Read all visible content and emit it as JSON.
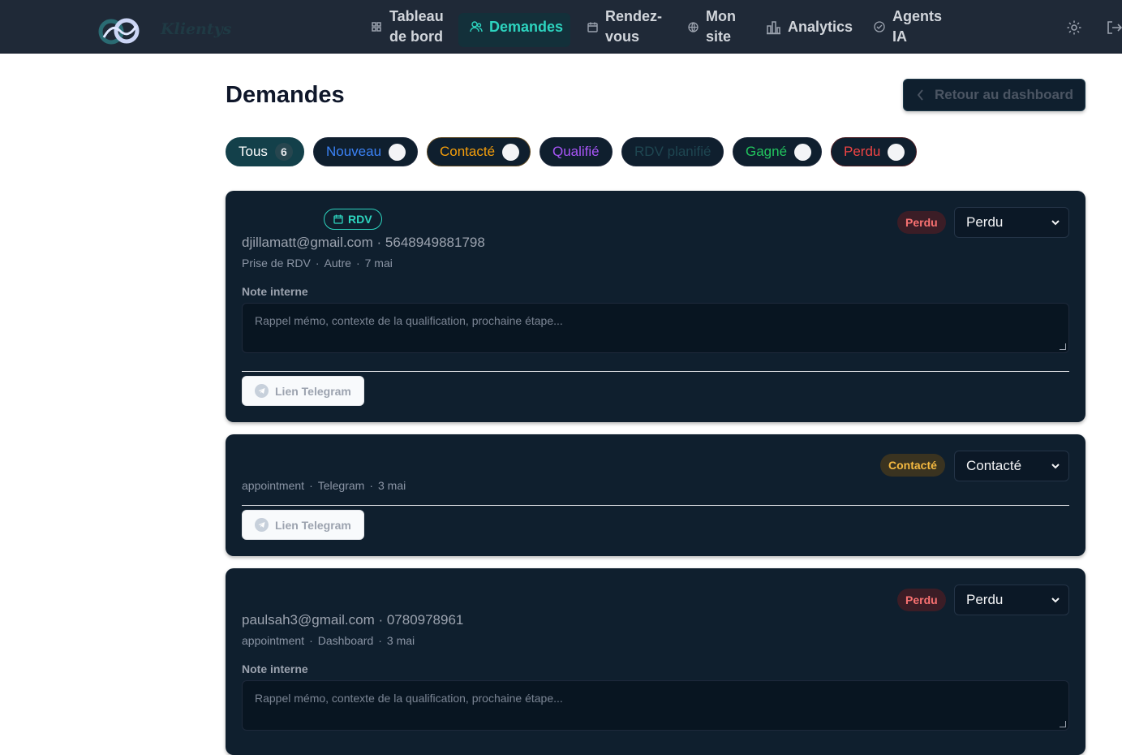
{
  "app": {
    "brand": "Klientys"
  },
  "nav": {
    "items": [
      {
        "label_1": "Tableau",
        "label_2": "de bord",
        "icon": "grid-icon"
      },
      {
        "label": "Demandes",
        "icon": "users-icon",
        "active": true
      },
      {
        "label_1": "Rendez-",
        "label_2": "vous",
        "icon": "calendar-icon"
      },
      {
        "label_1": "Mon",
        "label_2": "site",
        "icon": "globe-icon"
      },
      {
        "label": "Analytics",
        "icon": "bar-chart-icon"
      },
      {
        "label_1": "Agents",
        "label_2": "IA",
        "icon": "bot-icon"
      }
    ]
  },
  "page": {
    "title": "Demandes",
    "back_label": "Retour au dashboard"
  },
  "filters": {
    "all": {
      "label": "Tous",
      "count": "6"
    },
    "nouveau": {
      "label": "Nouveau",
      "color": "#3b82f6"
    },
    "contacte": {
      "label": "Contacté",
      "color": "#f59e0b"
    },
    "qualifie": {
      "label": "Qualifié",
      "color": "#a855f7"
    },
    "rdv": {
      "label": "RDV planifié",
      "color": "#1e4651"
    },
    "gagne": {
      "label": "Gagné",
      "color": "#22c55e"
    },
    "perdu": {
      "label": "Perdu",
      "color": "#ef4444"
    }
  },
  "requests": [
    {
      "badge": "RDV",
      "contact": "djillamatt@gmail.com · 5648949881798",
      "meta": {
        "source": "Prise de RDV",
        "channel": "Autre",
        "date": "7 mai"
      },
      "status_badge": "Perdu",
      "status_select": "Perdu",
      "note_label": "Note interne",
      "note_placeholder": "Rappel mémo, contexte de la qualification, prochaine étape...",
      "telegram_label": "Lien Telegram"
    },
    {
      "meta": {
        "source": "appointment",
        "channel": "Telegram",
        "date": "3 mai"
      },
      "status_badge": "Contacté",
      "status_select": "Contacté",
      "telegram_label": "Lien Telegram"
    },
    {
      "contact": "paulsah3@gmail.com · 0780978961",
      "meta": {
        "source": "appointment",
        "channel": "Dashboard",
        "date": "3 mai"
      },
      "status_badge": "Perdu",
      "status_select": "Perdu",
      "note_label": "Note interne",
      "note_placeholder": "Rappel mémo, contexte de la qualification, prochaine étape..."
    }
  ]
}
